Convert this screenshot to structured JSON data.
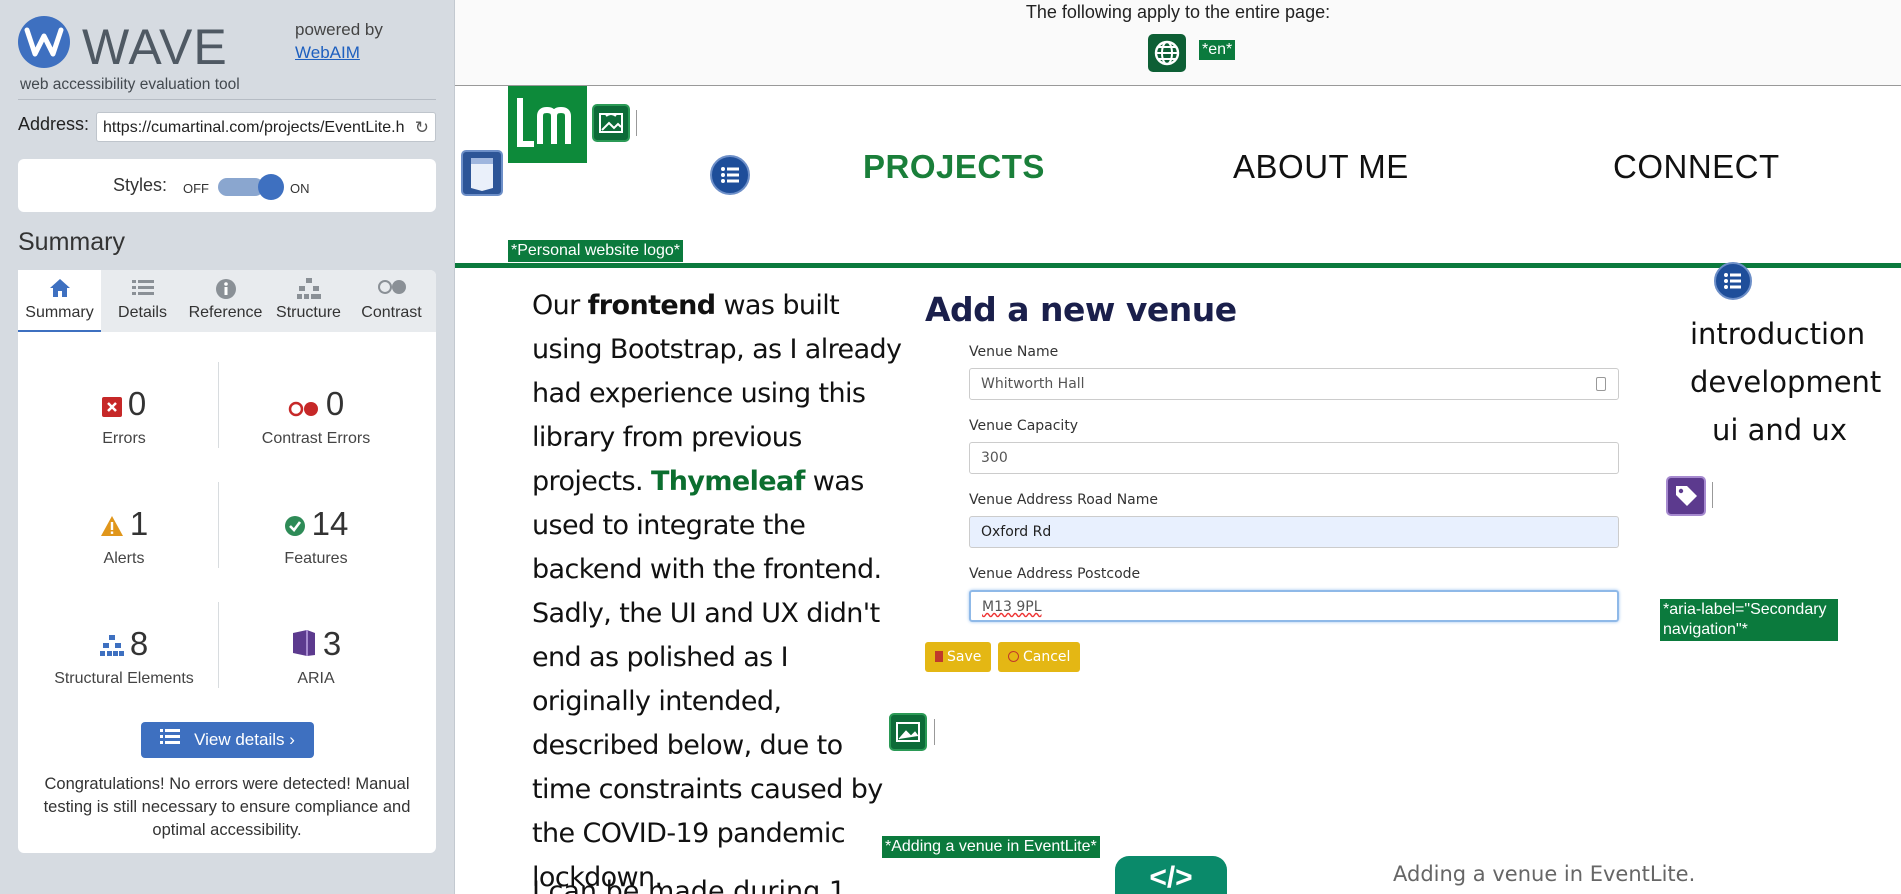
{
  "wave": {
    "brand_name": "WAVE",
    "tagline": "web accessibility evaluation tool",
    "powered_by": "powered by",
    "webaim": "WebAIM",
    "address_label": "Address:",
    "address_value": "https://cumartinal.com/projects/EventLite.h",
    "styles_label": "Styles:",
    "styles_off": "OFF",
    "styles_on": "ON",
    "styles_state": "on",
    "summary_heading": "Summary",
    "tabs": [
      {
        "label": "Summary",
        "icon": "home-icon",
        "active": true
      },
      {
        "label": "Details",
        "icon": "list-icon",
        "active": false
      },
      {
        "label": "Reference",
        "icon": "info-icon",
        "active": false
      },
      {
        "label": "Structure",
        "icon": "hierarchy-icon",
        "active": false
      },
      {
        "label": "Contrast",
        "icon": "contrast-icon",
        "active": false
      }
    ],
    "stats": {
      "errors": {
        "count": "0",
        "label": "Errors",
        "color": "#c62828"
      },
      "contrast_errors": {
        "count": "0",
        "label": "Contrast Errors",
        "color": "#c62828"
      },
      "alerts": {
        "count": "1",
        "label": "Alerts",
        "color": "#e0961b"
      },
      "features": {
        "count": "14",
        "label": "Features",
        "color": "#2e8b57"
      },
      "structural": {
        "count": "8",
        "label": "Structural Elements",
        "color": "#3e70c0"
      },
      "aria": {
        "count": "3",
        "label": "ARIA",
        "color": "#5c3a8e"
      }
    },
    "view_details": "View details ›",
    "congrats": "Congratulations! No errors were detected! Manual testing is still necessary to ensure compliance and optimal accessibility."
  },
  "page": {
    "notice": "The following apply to the entire page:",
    "lang_tag": "*en*",
    "nav": [
      "PROJECTS",
      "ABOUT ME",
      "CONNECT"
    ],
    "logo_alt": "*Personal website logo*",
    "article_parts": {
      "p1": "Our ",
      "frontend": "frontend",
      "p2": " was built using Bootstrap, as I already had experience using this library from previous projects. ",
      "thymeleaf": "Thymeleaf",
      "p3": " was used to integrate the backend with the frontend. Sadly, the UI and UX didn't end as polished as I originally intended, described below, due to time constraints caused by the COVID-19 pandemic lockdown."
    },
    "next_para": "I can be made during 1",
    "screenshot": {
      "title": "Add a new venue",
      "fields": [
        {
          "label": "Venue Name",
          "value": "Whitworth Hall"
        },
        {
          "label": "Venue Capacity",
          "value": "300"
        },
        {
          "label": "Venue Address Road Name",
          "value": "Oxford Rd"
        },
        {
          "label": "Venue Address Postcode",
          "value": "M13 9PL"
        }
      ],
      "save": "Save",
      "cancel": "Cancel"
    },
    "figure_alt": "*Adding a venue in EventLite*",
    "caption": "Adding a venue in EventLite.",
    "side_nav": [
      "introduction",
      "development",
      "ui and ux"
    ],
    "aria_label_tag": "*aria-label=\"Secondary navigation\"*",
    "code_icon": "</>"
  }
}
